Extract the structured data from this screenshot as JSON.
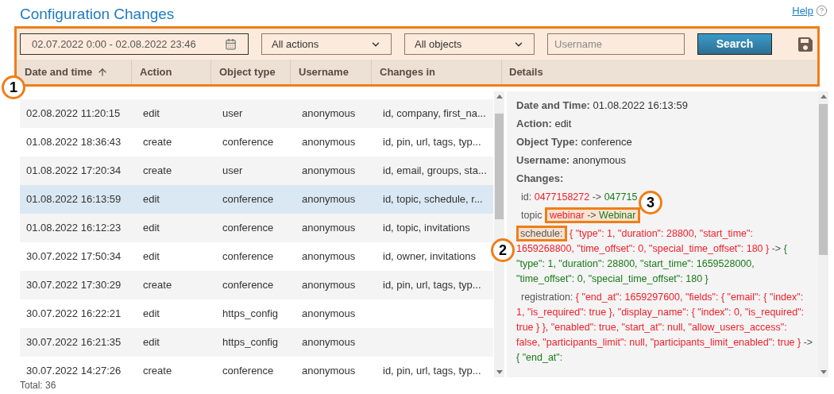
{
  "title": "Configuration Changes",
  "help": {
    "label": "Help"
  },
  "filters": {
    "date_range": "02.07.2022 0:00 - 02.08.2022 23:46",
    "actions": "All actions",
    "objects": "All objects",
    "username": {
      "placeholder": "Username"
    },
    "search_button": "Search"
  },
  "table": {
    "columns": [
      {
        "label": "Date and time",
        "sorted": true
      },
      {
        "label": "Action",
        "sorted": false
      },
      {
        "label": "Object type",
        "sorted": false
      },
      {
        "label": "Username",
        "sorted": false
      },
      {
        "label": "Changes in",
        "sorted": false
      }
    ],
    "rows": [
      {
        "cells": [
          "02.08.2022 11:20:15",
          "edit",
          "user",
          "anonymous",
          "id, company, first_na..."
        ],
        "selected": false
      },
      {
        "cells": [
          "01.08.2022 18:36:43",
          "create",
          "conference",
          "anonymous",
          "id, pin, url, tags, typ..."
        ],
        "selected": false
      },
      {
        "cells": [
          "01.08.2022 17:20:34",
          "create",
          "user",
          "anonymous",
          "id, email, groups, sta..."
        ],
        "selected": false
      },
      {
        "cells": [
          "01.08.2022 16:13:59",
          "edit",
          "conference",
          "anonymous",
          "id, topic, schedule, r..."
        ],
        "selected": true
      },
      {
        "cells": [
          "01.08.2022 16:12:23",
          "edit",
          "conference",
          "anonymous",
          "id, topic, invitations"
        ],
        "selected": false
      },
      {
        "cells": [
          "30.07.2022 17:50:34",
          "edit",
          "conference",
          "anonymous",
          "id, owner, invitations"
        ],
        "selected": false
      },
      {
        "cells": [
          "30.07.2022 17:30:29",
          "create",
          "conference",
          "anonymous",
          "id, pin, url, tags, typ..."
        ],
        "selected": false
      },
      {
        "cells": [
          "30.07.2022 16:22:21",
          "edit",
          "https_config",
          "anonymous",
          ""
        ],
        "selected": false
      },
      {
        "cells": [
          "30.07.2022 16:21:35",
          "edit",
          "https_config",
          "anonymous",
          ""
        ],
        "selected": false
      },
      {
        "cells": [
          "30.07.2022 14:27:26",
          "create",
          "conference",
          "anonymous",
          "id, pin, url, tags, typ..."
        ],
        "selected": false
      }
    ],
    "total": "Total: 36"
  },
  "details": {
    "heading": "Details",
    "fields": [
      {
        "label": "Date and Time:",
        "value": "01.08.2022 16:13:59"
      },
      {
        "label": "Action:",
        "value": "edit"
      },
      {
        "label": "Object Type:",
        "value": "conference"
      },
      {
        "label": "Username:",
        "value": "anonymous"
      }
    ],
    "changes_label": "Changes:",
    "changes": [
      {
        "field": "id:",
        "old": "0477158272",
        "arrow": "->",
        "new": "047715",
        "field_highlighted": false,
        "values_highlighted": false
      },
      {
        "field": "topic",
        "old": "webinar",
        "arrow": "->",
        "new": "Webinar",
        "field_highlighted": false,
        "values_highlighted": true
      },
      {
        "field": "schedule:",
        "old": "{ \"type\": 1, \"duration\": 28800, \"start_time\": 1659268800, \"time_offset\": 0, \"special_time_offset\": 180 }",
        "arrow": "->",
        "new": "{ \"type\": 1, \"duration\": 28800, \"start_time\": 1659528000, \"time_offset\": 0, \"special_time_offset\": 180 }",
        "field_highlighted": true,
        "values_highlighted": false
      },
      {
        "field": "registration:",
        "old": "{ \"end_at\": 1659297600, \"fields\": { \"email\": { \"index\": 1, \"is_required\": true }, \"display_name\": { \"index\": 0, \"is_required\": true } }, \"enabled\": true, \"start_at\": null, \"allow_users_access\": false, \"participants_limit\": null, \"participants_limit_enabled\": true }",
        "arrow": "->",
        "new": "{ \"end_at\":",
        "field_highlighted": false,
        "values_highlighted": false
      }
    ]
  },
  "callouts": [
    {
      "number": "1",
      "kind": "toolbar"
    },
    {
      "number": "2",
      "kind": "schedule"
    },
    {
      "number": "3",
      "kind": "topic"
    }
  ]
}
